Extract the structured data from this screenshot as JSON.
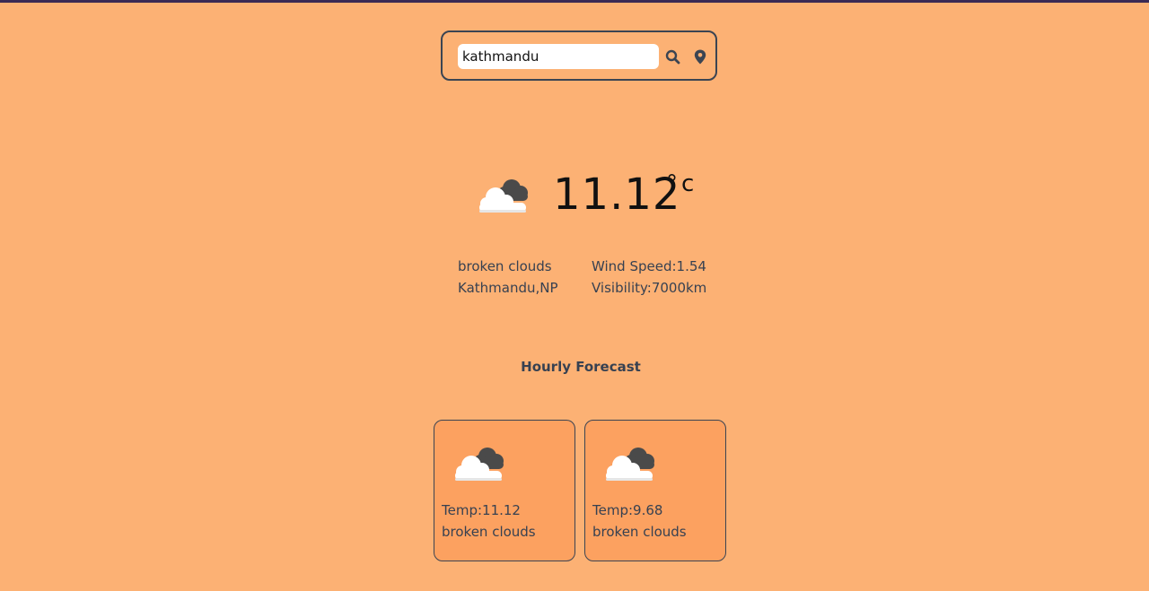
{
  "search": {
    "value": "kathmandu",
    "search_icon": "search-icon",
    "location_icon": "location-pin-icon"
  },
  "current": {
    "icon": "broken-clouds-icon",
    "temperature": "11.12",
    "unit": "°c",
    "description": "broken clouds",
    "location": "Kathmandu,NP",
    "wind_speed": "Wind Speed:1.54",
    "visibility": "Visibility:7000km"
  },
  "hourly": {
    "title": "Hourly Forecast",
    "items": [
      {
        "icon": "broken-clouds-icon",
        "temp": "Temp:11.12",
        "description": "broken clouds"
      },
      {
        "icon": "broken-clouds-icon",
        "temp": "Temp:9.68",
        "description": "broken clouds"
      }
    ]
  },
  "colors": {
    "background": "#fcb174",
    "card_background": "#fca160",
    "border": "#3b4452",
    "text": "#374151",
    "top_bar": "#3b2a54"
  }
}
